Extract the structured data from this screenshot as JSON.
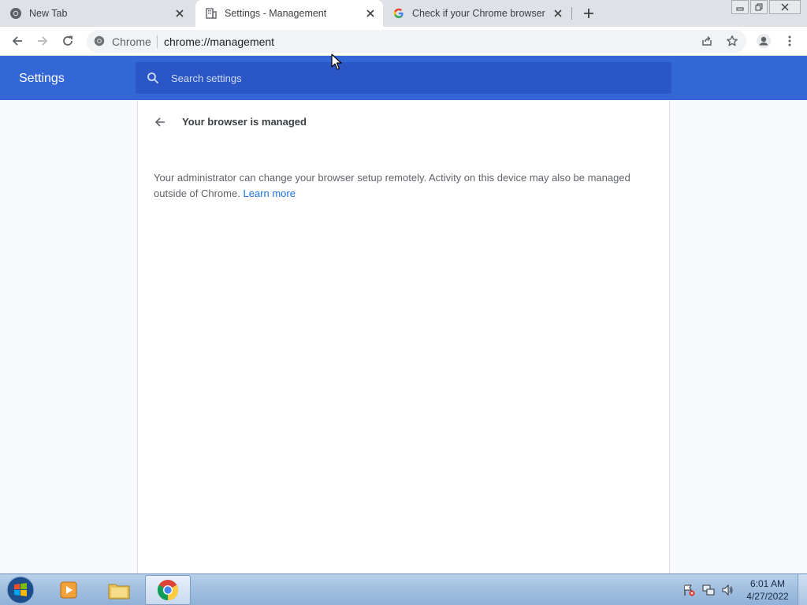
{
  "tabs": [
    {
      "title": "New Tab",
      "favicon": "chrome-icon"
    },
    {
      "title": "Settings - Management",
      "favicon": "building-icon",
      "active": true
    },
    {
      "title": "Check if your Chrome browser is",
      "favicon": "google-icon"
    }
  ],
  "toolbar": {
    "site_chip": "Chrome",
    "url": "chrome://management"
  },
  "settings": {
    "title": "Settings",
    "search_placeholder": "Search settings"
  },
  "page": {
    "title": "Your browser is managed",
    "description": "Your administrator can change your browser setup remotely. Activity on this device may also be managed outside of Chrome.",
    "learn_more": "Learn more"
  },
  "taskbar": {
    "time": "6:01 AM",
    "date": "4/27/2022"
  },
  "colors": {
    "settings_header": "#3367d6",
    "search_box": "#2a56c6",
    "link": "#1a73e8",
    "tabstrip": "#dee1e6"
  }
}
